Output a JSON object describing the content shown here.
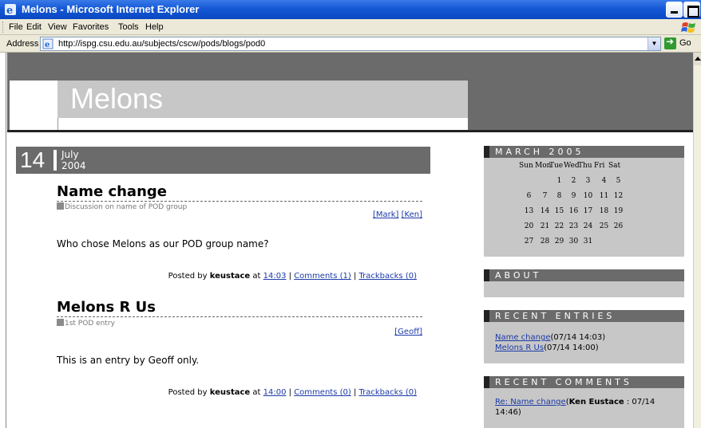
{
  "window": {
    "title": "Melons - Microsoft Internet Explorer"
  },
  "menu": {
    "items": [
      {
        "label": "File"
      },
      {
        "label": "Edit"
      },
      {
        "label": "View"
      },
      {
        "label": "Favorites"
      },
      {
        "label": "Tools"
      },
      {
        "label": "Help"
      }
    ]
  },
  "address": {
    "label": "Address",
    "url": "http://ispg.csu.edu.au/subjects/cscw/pods/blogs/pod0",
    "go_label": "Go"
  },
  "blog": {
    "title": "Melons"
  },
  "date": {
    "day": "14",
    "month": "July",
    "year": "2004"
  },
  "entries": [
    {
      "title": "Name change",
      "category": "Discussion on name of POD group",
      "authors": [
        "[Mark]",
        "[Ken]"
      ],
      "body": "Who chose Melons as our POD group name?",
      "posted_by_prefix": "Posted by",
      "author": "keustace",
      "at": "at",
      "time": "14:03",
      "comments": "Comments (1)",
      "trackbacks": "Trackbacks (0)"
    },
    {
      "title": "Melons R Us",
      "category": "1st POD entry",
      "authors": [
        "[Geoff]"
      ],
      "body": "This is an entry by Geoff only.",
      "posted_by_prefix": "Posted by",
      "author": "keustace",
      "at": "at",
      "time": "14:00",
      "comments": "Comments (0)",
      "trackbacks": "Trackbacks (0)"
    }
  ],
  "sidebar": {
    "calendar": {
      "heading": "MARCH 2005",
      "weekdays": [
        "Sun",
        "Mon",
        "Tue",
        "Wed",
        "Thu",
        "Fri",
        "Sat"
      ],
      "weeks": [
        [
          "",
          "",
          "1",
          "2",
          "3",
          "4",
          "5"
        ],
        [
          "6",
          "7",
          "8",
          "9",
          "10",
          "11",
          "12"
        ],
        [
          "13",
          "14",
          "15",
          "16",
          "17",
          "18",
          "19"
        ],
        [
          "20",
          "21",
          "22",
          "23",
          "24",
          "25",
          "26"
        ],
        [
          "27",
          "28",
          "29",
          "30",
          "31",
          "",
          ""
        ]
      ]
    },
    "about": {
      "heading": "ABOUT"
    },
    "recent_entries": {
      "heading": "RECENT ENTRIES",
      "items": [
        {
          "link": "Name change",
          "meta": "(07/14 14:03)"
        },
        {
          "link": "Melons R Us",
          "meta": "(07/14 14:00)"
        }
      ]
    },
    "recent_comments": {
      "heading": "RECENT COMMENTS",
      "items": [
        {
          "link": "Re: Name change",
          "open": "(",
          "author": "Ken Eustace",
          "meta": " : 07/14",
          "meta2": "14:46)"
        }
      ]
    }
  }
}
